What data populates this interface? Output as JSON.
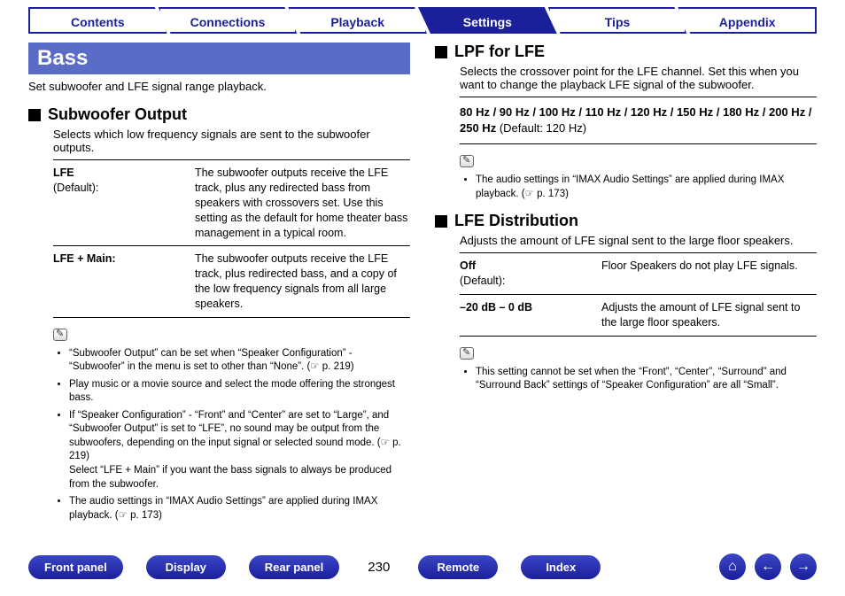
{
  "tabs": {
    "contents": "Contents",
    "connections": "Connections",
    "playback": "Playback",
    "settings": "Settings",
    "tips": "Tips",
    "appendix": "Appendix",
    "active": "settings"
  },
  "page": {
    "title": "Bass",
    "subtitle": "Set subwoofer and LFE signal range playback.",
    "number": "230"
  },
  "subwoofer_output": {
    "heading": "Subwoofer Output",
    "desc": "Selects which low frequency signals are sent to the subwoofer outputs.",
    "rows": [
      {
        "key_main": "LFE",
        "key_sub": "(Default):",
        "val": "The subwoofer outputs receive the LFE track, plus any redirected bass from speakers with crossovers set. Use this setting as the default for home theater bass management in a typical room."
      },
      {
        "key_main": "LFE + Main:",
        "key_sub": "",
        "val": "The subwoofer outputs receive the LFE track, plus redirected bass, and a copy of the low frequency signals from all large speakers."
      }
    ],
    "notes": [
      "“Subwoofer Output” can be set when “Speaker Configuration” - “Subwoofer” in the menu is set to other than “None”.  (☞ p. 219)",
      "Play music or a movie source and select the mode offering the strongest bass.",
      "If “Speaker Configuration” - “Front” and “Center” are set to “Large”, and “Subwoofer Output” is set to “LFE”, no sound may be output from the subwoofers, depending on the input signal or selected sound mode.  (☞ p. 219)\nSelect “LFE + Main” if you want the bass signals to always be produced from the subwoofer.",
      "The audio settings in “IMAX Audio Settings” are applied during IMAX playback.  (☞ p. 173)"
    ]
  },
  "lpf": {
    "heading": "LPF for LFE",
    "desc": "Selects the crossover point for the LFE channel. Set this when you want to change the playback LFE signal of the subwoofer.",
    "options": "80 Hz / 90 Hz / 100 Hz / 110 Hz / 120 Hz / 150 Hz / 180 Hz / 200 Hz / 250 Hz",
    "default": " (Default: 120 Hz)",
    "notes": [
      "The audio settings in “IMAX Audio Settings” are applied during IMAX playback.  (☞ p. 173)"
    ]
  },
  "lfe_dist": {
    "heading": "LFE Distribution",
    "desc": "Adjusts the amount of LFE signal sent to the large floor speakers.",
    "rows": [
      {
        "key_main": "Off",
        "key_sub": "(Default):",
        "val": "Floor Speakers do not play LFE signals."
      },
      {
        "key_main": "–20 dB – 0 dB",
        "key_sub": "",
        "val": "Adjusts the amount of LFE signal sent to the large floor speakers."
      }
    ],
    "notes": [
      "This setting cannot be set when the “Front”, “Center”, “Surround” and “Surround Back” settings of “Speaker Configuration” are all “Small”."
    ]
  },
  "bottom": {
    "front": "Front panel",
    "display": "Display",
    "rear": "Rear panel",
    "remote": "Remote",
    "index": "Index"
  },
  "icons": {
    "home": "⌂",
    "prev": "←",
    "next": "→"
  }
}
